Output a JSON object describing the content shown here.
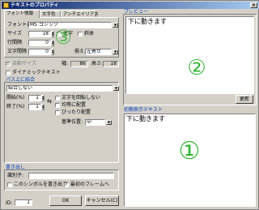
{
  "window": {
    "title": "テキストのプロパティ",
    "close_glyph": "×"
  },
  "tabs": [
    {
      "label": "フォント情報",
      "active": true
    },
    {
      "label": "文字色",
      "active": false
    },
    {
      "label": "アンチエイリアス",
      "active": false
    }
  ],
  "font": {
    "name_label": "フォント名:",
    "name_value": "MS ゴシック",
    "size_label": "サイズ",
    "size_value": "18",
    "bold_label": "太字",
    "italic_label": "斜体",
    "line_spacing_label": "行間隔",
    "line_spacing_value": "0",
    "char_spacing_label": "文字間隔",
    "char_spacing_value": "0",
    "align_label": "揃え",
    "align_value": "左寄せ"
  },
  "auto_size": {
    "label": "自動サイズ",
    "width_label": "幅:",
    "width_value": "86",
    "height_label": "高さ:",
    "height_value": "18"
  },
  "dynamic_text": {
    "label": "ダイナミックテキスト"
  },
  "path_bind": {
    "title": "パス上に結合",
    "select_value": "結合しない",
    "start_label": "開始(%)",
    "start_value": "1",
    "end_label": "終了(%)",
    "end_value": "1",
    "no_rotate_label": "文字を回転しない",
    "even_label": "均等に配置",
    "fit_label": "ぴったり配置",
    "base_label": "基準位置:",
    "base_value": "中"
  },
  "export": {
    "title": "書き出し",
    "var_label": "識別子:",
    "var_value": "",
    "symbol_label": "このシンボルを書き出す",
    "first_frame_label": "最初のフレームへ"
  },
  "id_field": {
    "label": "ID:",
    "value": "1"
  },
  "buttons": {
    "ok": "OK",
    "cancel": "キャンセル(C)",
    "update": "更新"
  },
  "preview": {
    "title": "プレビュー",
    "text": "下に動きます"
  },
  "initial_text": {
    "title": "初期表示テキスト",
    "text": "下に動きます"
  },
  "annotations": {
    "one": "①",
    "two": "②",
    "three": "③"
  },
  "colors": {
    "accent": "#33b533",
    "group_title": "#0040c0"
  }
}
